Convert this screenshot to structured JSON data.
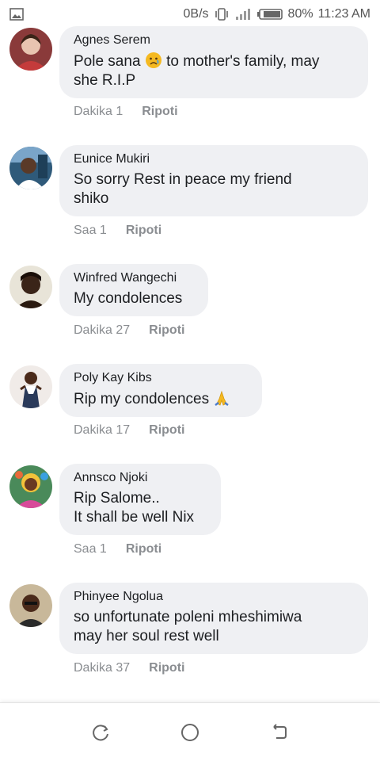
{
  "status_bar": {
    "speed": "0B/s",
    "battery": "80%",
    "time": "11:23 AM"
  },
  "comments": [
    {
      "author": "Agnes Serem",
      "text_before": "Pole sana ",
      "emoji": "sad-face",
      "text_after": " to mother's family, may\nshe R.I.P",
      "time": "Dakika 1",
      "report": "Ripoti"
    },
    {
      "author": "Eunice Mukiri",
      "text": "So sorry Rest in peace my friend\nshiko",
      "time": "Saa 1",
      "report": "Ripoti"
    },
    {
      "author": "Winfred Wangechi",
      "text": "My condolences",
      "time": "Dakika 27",
      "report": "Ripoti"
    },
    {
      "author": "Poly Kay Kibs",
      "text_before": "Rip my condolences ",
      "emoji": "praying-hands",
      "text_after": "",
      "time": "Dakika 17",
      "report": "Ripoti"
    },
    {
      "author": "Annsco Njoki",
      "text": "Rip Salome..\nIt shall be well Nix",
      "time": "Saa 1",
      "report": "Ripoti"
    },
    {
      "author": "Phinyee Ngolua",
      "text": "so unfortunate poleni mheshimiwa\nmay her soul rest well",
      "time": "Dakika 37",
      "report": "Ripoti"
    }
  ],
  "colors": {
    "bubble": "#eff0f3",
    "meta_text": "#8a8d91",
    "emoji_sad": "#f5b921"
  },
  "nav_icons": [
    "recents-icon",
    "home-icon",
    "back-icon"
  ]
}
